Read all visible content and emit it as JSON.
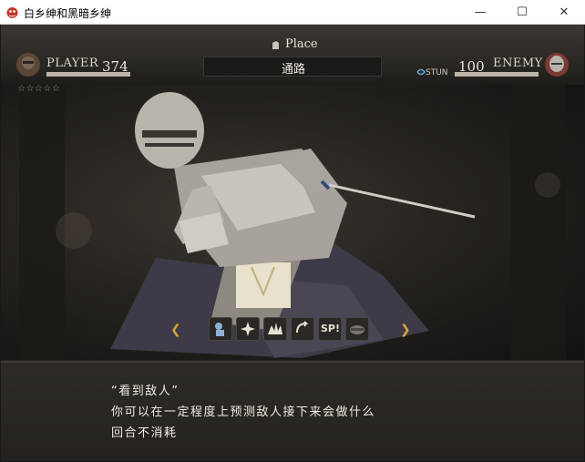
{
  "window": {
    "title": "白乡绅和黑暗乡绅",
    "minimize_glyph": "—",
    "maximize_glyph": "☐",
    "close_glyph": "✕"
  },
  "hud": {
    "place_label": "Place",
    "place_name": "通路",
    "player": {
      "label": "PLAYER",
      "hp": "374",
      "hp_fraction": 1.0,
      "stars": "☆☆☆☆☆"
    },
    "enemy": {
      "label": "ENEMY",
      "hp": "100",
      "hp_fraction": 1.0,
      "status": "STUN"
    }
  },
  "skills": {
    "left_arrow": "❮",
    "right_arrow": "❯",
    "items": [
      "grab-icon",
      "burst-icon",
      "explosion-icon",
      "spin-icon",
      "sp-icon",
      "guard-icon"
    ],
    "sp_text": "SP!"
  },
  "dialog": {
    "line1": "“看到敌人”",
    "line2": "你可以在一定程度上预测敌人接下来会做什么",
    "line3": "回合不消耗"
  },
  "colors": {
    "accent": "#d4a63a",
    "text": "#efebe3",
    "panel": "#24211e"
  }
}
